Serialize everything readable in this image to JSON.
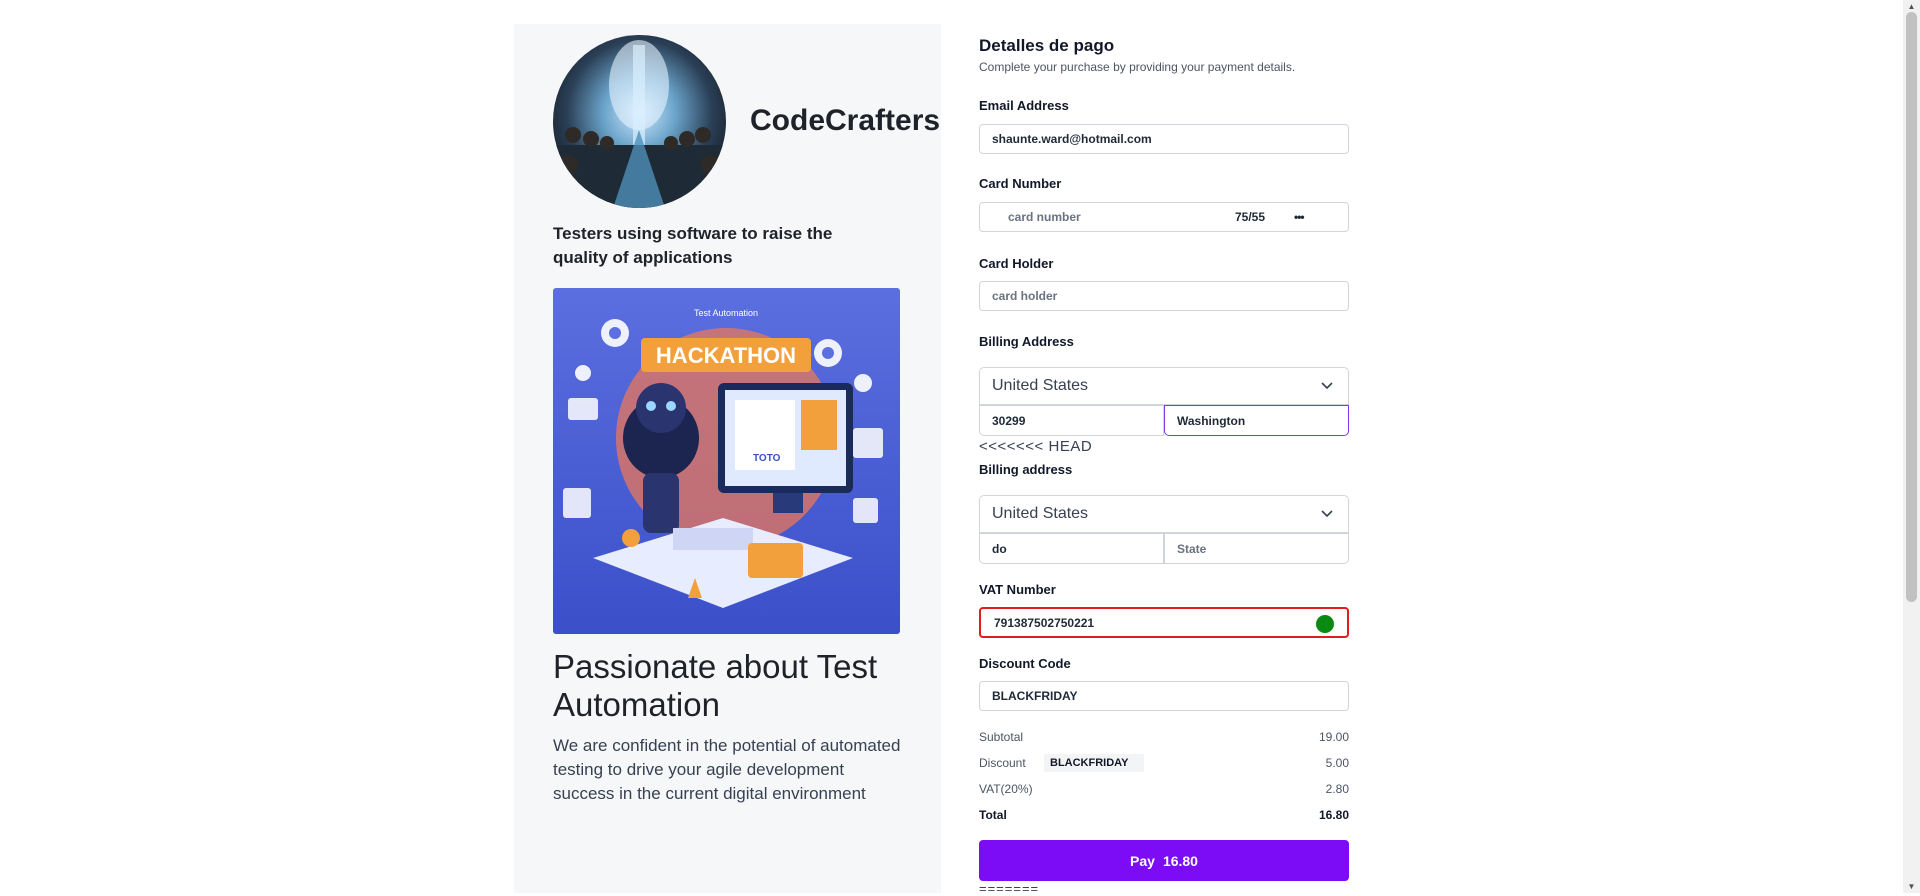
{
  "left": {
    "brand_name": "CodeCrafters",
    "tagline": "Testers using software to raise the quality of applications",
    "poster_title": "HACKATHON",
    "poster_subtitle": "Test Automation",
    "poster_text": "TOTO",
    "headline": "Passionate about Test Automation",
    "paragraph": "We are confident in the potential of automated testing to drive your agile development success in the current digital environment"
  },
  "form": {
    "title": "Detalles de pago",
    "subtitle": "Complete your purchase by providing your payment details.",
    "email_label": "Email Address",
    "email_value": "shaunte.ward@hotmail.com",
    "card_number_label": "Card Number",
    "card_number_placeholder": "card number",
    "card_expiry": "75/55",
    "card_cvc": "•••",
    "card_holder_label": "Card Holder",
    "card_holder_placeholder": "card holder",
    "billing_address_label": "Billing Address",
    "billing_country": "United States",
    "billing_zip": "30299",
    "billing_state": "Washington",
    "conflict_marker": "<<<<<<< HEAD",
    "billing_address2_label": "Billing address",
    "billing2_country": "United States",
    "billing2_zip": "do",
    "billing2_state_placeholder": "State",
    "vat_label": "VAT Number",
    "vat_value": "791387502750221",
    "discount_label": "Discount Code",
    "discount_value": "BLACKFRIDAY",
    "summary": {
      "subtotal_label": "Subtotal",
      "subtotal_value": "19.00",
      "discount_label": "Discount",
      "discount_code": "BLACKFRIDAY",
      "discount_value": "5.00",
      "vat_label": "VAT(20%)",
      "vat_value": "2.80",
      "total_label": "Total",
      "total_value": "16.80"
    },
    "pay_label": "Pay",
    "pay_amount": "16.80",
    "bottom_marker": "======="
  },
  "colors": {
    "accent": "#7c0cf5",
    "error_border": "#e11d1d",
    "valid_dot": "#0a8a12",
    "focus_border": "#7c3aed"
  }
}
